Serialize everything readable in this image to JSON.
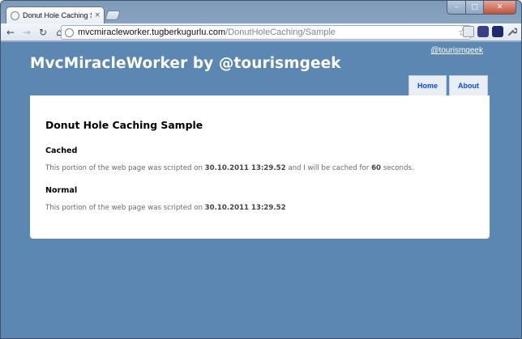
{
  "browser": {
    "tab_title": "Donut Hole Caching Sampl",
    "tab_close": "×",
    "url_host": "mvcmiracleworker.tugberkugurlu.com",
    "url_path": "/DonutHoleCaching/Sample",
    "window_controls": {
      "minimize": "–",
      "maximize": "□",
      "close": "✕"
    },
    "nav": {
      "back": "←",
      "forward": "→",
      "reload": "↻",
      "home": "⌂"
    },
    "star": "☆",
    "icons": [
      "page-icon",
      "extension-icon",
      "extension-icon",
      "wrench-icon"
    ]
  },
  "site": {
    "title": "MvcMiracleWorker by @tourismgeek",
    "header_link": "@tourismgeek",
    "menu": [
      {
        "label": "Home"
      },
      {
        "label": "About"
      }
    ]
  },
  "main": {
    "heading": "Donut Hole Caching Sample",
    "cached": {
      "heading": "Cached",
      "text_before": "This portion of the web page was scripted on ",
      "timestamp": "30.10.2011 13:29.52",
      "text_middle": " and I will be cached for ",
      "seconds": "60",
      "text_after": " seconds."
    },
    "normal": {
      "heading": "Normal",
      "text_before": "This portion of the web page was scripted on ",
      "timestamp": "30.10.2011 13:29.52"
    }
  },
  "colors": {
    "page_background": "#5c87b2",
    "menu_link": "#034af3",
    "body_text": "#696969"
  }
}
